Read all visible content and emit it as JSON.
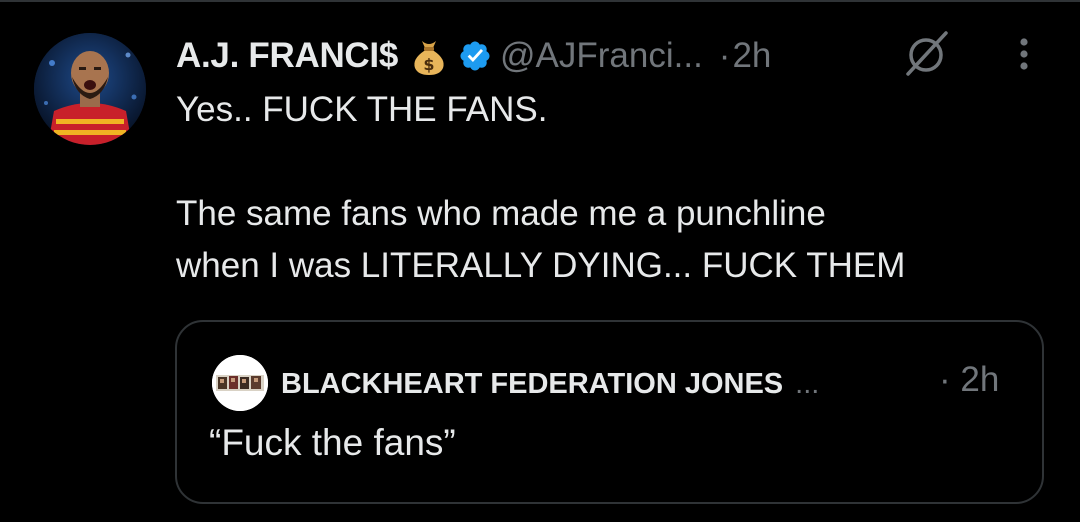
{
  "tweet": {
    "display_name": "A.J. FRANCI$",
    "handle": "@AJFranci...",
    "separator": "·",
    "timestamp": "2h",
    "lines": [
      "Yes.. FUCK THE FANS.",
      "The same fans who made me a punchline",
      "when I was LITERALLY DYING... FUCK THEM"
    ],
    "icons": {
      "name_emoji": "money-bag-icon",
      "verified": "verified-badge-icon",
      "grok": "grok-icon",
      "more": "more-options-icon"
    }
  },
  "quoted_tweet": {
    "display_name": "BLACKHEART FEDERATION JONES",
    "truncation": "...",
    "timestamp": "· 2h",
    "text": "“Fuck the fans”"
  },
  "colors": {
    "background": "#000000",
    "primary_text": "#e7e9ea",
    "secondary_text": "#71767b",
    "border": "#2f3336",
    "verified_blue": "#1d9bf0"
  }
}
